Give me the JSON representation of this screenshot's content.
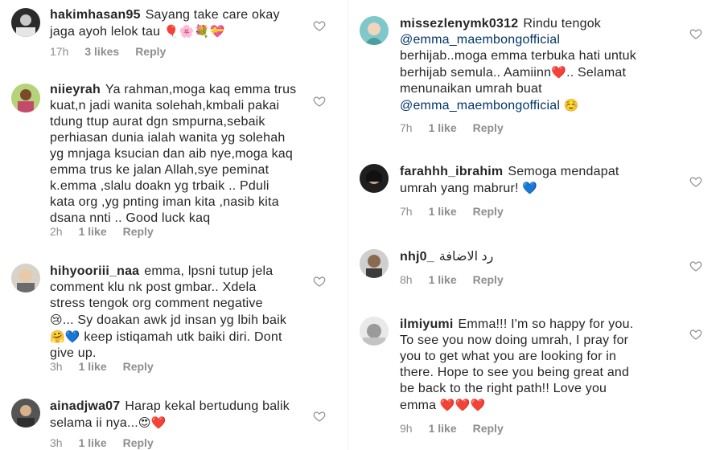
{
  "left": [
    {
      "username": "hakimhasan95",
      "text": "Sayang take care okay\njaga ayoh lelok tau",
      "emojis": "🎈🌸💐💝",
      "time": "17h",
      "likes": "3 likes",
      "reply": "Reply"
    },
    {
      "username": "niieyrah",
      "text": "Ya rahman,moga kaq emma trus\nkuat,n jadi wanita solehah,kmbali pakai\ntdung ttup aurat dgn smpurna,sebaik\nperhiasan dunia ialah wanita yg solehah\nyg mnjaga ksucian dan aib nye,moga kaq\nemma trus ke jalan Allah,sye peminat\nk.emma ,slalu doakn yg trbaik .. Pduli\nkata org ,yg pnting iman kita ,nasib kita\ndsana nnti .. Good luck kaq",
      "time": "2h",
      "likes": "1 like",
      "reply": "Reply"
    },
    {
      "username": "hihyooriii_naa",
      "text_1": "emma, lpsni tutup jela\ncomment klu nk post gmbar.. Xdela\nstress tengok org comment negative\n",
      "emoji_1": "😢",
      "text_2": "... Sy doakan awk jd insan yg lbih baik\n",
      "emoji_2": "🤗",
      "emoji_3": "💙",
      "text_3": " keep istiqamah utk baiki diri. Dont\ngive up.",
      "time": "3h",
      "likes": "1 like",
      "reply": "Reply"
    },
    {
      "username": "ainadjwa07",
      "text": "Harap kekal bertudung balik\nselama ii nya...",
      "emoji_1": "😍",
      "emoji_2": "❤️",
      "time": "3h",
      "likes": "1 like",
      "reply": "Reply"
    }
  ],
  "right": [
    {
      "username": "missezlenymk0312",
      "text_1": "Rindu tengok\n",
      "mention_1": "@emma_maembongofficial",
      "text_2": "\nberhijab..moga emma terbuka hati untuk\nberhijab semula.. Aamiinn",
      "emoji_1": "❤️",
      "text_3": ".. Selamat\nmenunaikan umrah buat\n",
      "mention_2": "@emma_maembongofficial",
      "emoji_2": "☺️",
      "time": "7h",
      "likes": "1 like",
      "reply": "Reply"
    },
    {
      "username": "farahhh_ibrahim",
      "text": "Semoga mendapat\numrah yang mabrur!",
      "emoji": "💙",
      "time": "7h",
      "likes": "1 like",
      "reply": "Reply"
    },
    {
      "username": "nhj0_",
      "text": "رد الاضافة",
      "time": "8h",
      "likes": "1 like",
      "reply": "Reply"
    },
    {
      "username": "ilmiyumi",
      "text": "Emma!!! I'm so happy for you.\nTo see you now doing umrah, I pray for\nyou to get what you are looking for in\nthere. Hope to see you being great and\nbe back to the right path!! Love you\nemma",
      "emojis": "❤️❤️❤️",
      "time": "9h",
      "likes": "1 like",
      "reply": "Reply"
    }
  ],
  "colors": {
    "text": "#262626",
    "meta": "#8e8e8e",
    "mention": "#003569"
  },
  "icons": {
    "like": "heart-outline-icon"
  }
}
